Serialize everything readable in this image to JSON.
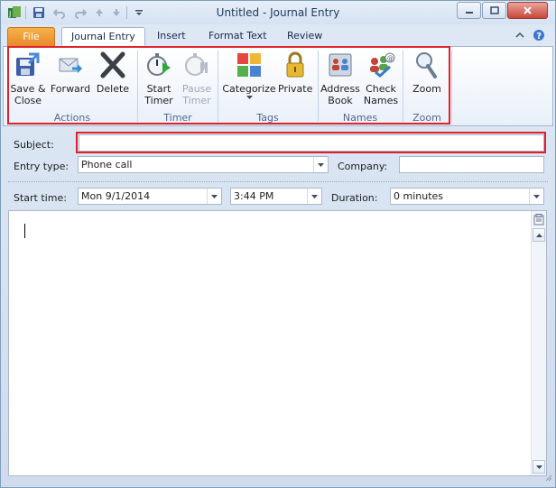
{
  "window": {
    "title": "Untitled  -  Journal Entry"
  },
  "quick_access": {
    "items": [
      "outlook-app-icon",
      "save-icon",
      "undo-icon",
      "redo-icon",
      "up-arrow-icon",
      "down-arrow-icon",
      "customize-icon"
    ]
  },
  "tabs": [
    {
      "label": "File"
    },
    {
      "label": "Journal Entry"
    },
    {
      "label": "Insert"
    },
    {
      "label": "Format Text"
    },
    {
      "label": "Review"
    }
  ],
  "ribbon": {
    "groups": {
      "actions": {
        "label": "Actions",
        "buttons": {
          "save_close": "Save &\nClose",
          "forward": "Forward",
          "delete": "Delete"
        }
      },
      "timer": {
        "label": "Timer",
        "buttons": {
          "start": "Start\nTimer",
          "pause": "Pause\nTimer"
        }
      },
      "tags": {
        "label": "Tags",
        "buttons": {
          "categorize": "Categorize",
          "private": "Private"
        }
      },
      "names": {
        "label": "Names",
        "buttons": {
          "address_book": "Address\nBook",
          "check_names": "Check\nNames"
        }
      },
      "zoom": {
        "label": "Zoom",
        "buttons": {
          "zoom": "Zoom"
        }
      }
    }
  },
  "form": {
    "subject": {
      "label": "Subject:",
      "value": ""
    },
    "entry_type": {
      "label": "Entry type:",
      "value": "Phone call"
    },
    "company": {
      "label": "Company:",
      "value": ""
    },
    "start_time": {
      "label": "Start time:",
      "date": "Mon 9/1/2014",
      "time": "3:44 PM"
    },
    "duration": {
      "label": "Duration:",
      "value": "0 minutes"
    }
  },
  "colors": {
    "highlight": "#e0202a",
    "file_tab": "#e8892b"
  }
}
